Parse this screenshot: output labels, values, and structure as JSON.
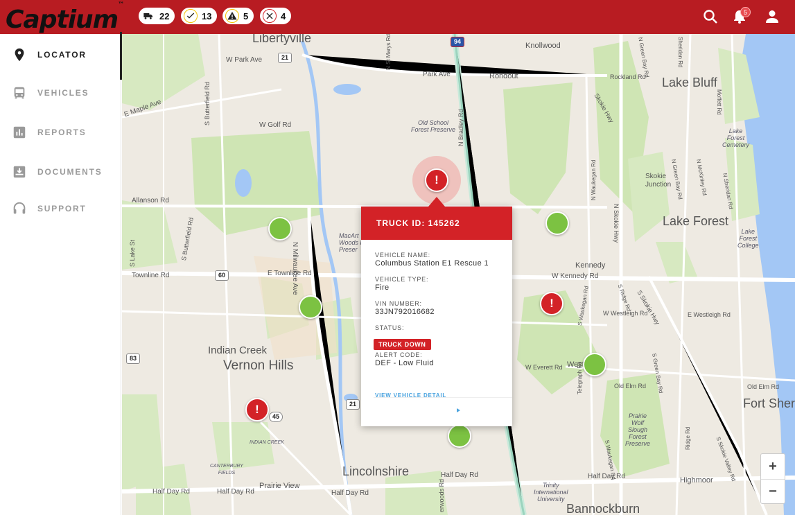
{
  "brand": {
    "name": "Captium",
    "mark": "™"
  },
  "header": {
    "counters": [
      {
        "icon": "truck-icon",
        "value": "22"
      },
      {
        "icon": "check-icon",
        "value": "13"
      },
      {
        "icon": "warning-icon",
        "value": "5"
      },
      {
        "icon": "x-icon",
        "value": "4"
      }
    ],
    "notification_count": "5"
  },
  "sidebar": {
    "items": [
      {
        "label": "LOCATOR",
        "icon": "map-pin-icon",
        "active": true
      },
      {
        "label": "VEHICLES",
        "icon": "bus-icon",
        "active": false
      },
      {
        "label": "REPORTS",
        "icon": "bar-chart-icon",
        "active": false
      },
      {
        "label": "DOCUMENTS",
        "icon": "document-download-icon",
        "active": false
      },
      {
        "label": "SUPPORT",
        "icon": "headset-icon",
        "active": false
      }
    ]
  },
  "map": {
    "places": {
      "libertyville": "Libertyville",
      "lake_bluff": "Lake Bluff",
      "lake_forest": "Lake Forest",
      "vernon_hills": "Vernon Hills",
      "indian_creek": "Indian Creek",
      "lincolnshire": "Lincolnshire",
      "bannockburn": "Bannockburn",
      "fort_sheridan": "Fort Sher",
      "knollwood": "Knollwood",
      "rondout": "Rondout",
      "kennedy": "Kennedy",
      "skokie_junction": "Skokie\nJunction",
      "prairie_view": "Prairie View",
      "highmoor": "Highmoor",
      "west_fork": "West",
      "old_school": "Old School\nForest Preserve",
      "mcarthur": "MacArt\nWoods F\nPreser",
      "lake_forest_cemetery": "Lake\nForest\nCemetery",
      "lake_forest_college": "Lake\nForest\nCollege",
      "prairie_wolf": "Prairie\nWolf\nSlough\nForest\nPreserve",
      "trinity": "Trinity\nInternational\nUniversity",
      "canterbury": "CANTERBURY\nFIELDS",
      "indian_creek_small": "INDIAN CREEK"
    },
    "roads": {
      "w_park_ave": "W Park Ave",
      "park_ave": "Park Ave",
      "e_maple_ave": "E Maple Ave",
      "w_golf_rd": "W Golf Rd",
      "allanson_rd": "Allanson Rd",
      "townline_rd": "Townline Rd",
      "e_townline_rd": "E Townline Rd",
      "w_kennedy_rd": "W Kennedy Rd",
      "w_westleigh_rd": "W Westleigh Rd",
      "e_westleigh_rd": "E Westleigh Rd",
      "w_everett_rd": "W Everett Rd",
      "old_elm_rd": "Old Elm Rd",
      "old_elm_rd2": "Old Elm Rd",
      "half_day_rd1": "Half Day Rd",
      "half_day_rd2": "Half Day Rd",
      "half_day_rd3": "Half Day Rd",
      "half_day_rd4": "Half Day Rd",
      "half_day_rd5": "Half Day Rd",
      "rockland_rd": "Rockland Rd",
      "n_milwaukee": "N Milwaukee Ave",
      "s_butterfield": "S Butterfield Rd",
      "s_butterfield2": "S Butterfield Rd",
      "s_lake_st": "S Lake St",
      "n_st_marys": "N St Marys Rd",
      "n_bradley": "N Bradley Rd",
      "skokie_hwy": "Skokie Hwy",
      "n_skokie_hwy": "N Skokie Hwy",
      "s_skokie_hwy": "S Skokie Hwy",
      "n_waukegan": "N Waukegan Rd",
      "s_waukegan": "S Waukegan Rd",
      "s_waukegan2": "S Waukegan Rd",
      "n_green_bay": "N Green Bay Rd",
      "s_green_bay": "S Green Bay Rd",
      "n_mckinley": "N McKinley Rd",
      "n_sheridan": "N Sheridan Rd",
      "moffett": "Moffett Rd",
      "s_ridge": "S Ridge Rd",
      "telegraph": "Telegraph Rd",
      "ridge_rd": "Ridge Rd",
      "sheridan_rd": "Sheridan Rd",
      "s_skokie_valley": "S Skokie Valley Rd",
      "n_green_bay_top": "N Green Bay Rd",
      "ashwoods": "erwoods Rd"
    },
    "shields": {
      "r21a": "21",
      "r21b": "21",
      "r60": "60",
      "r83": "83",
      "r45": "45",
      "i94": "94"
    }
  },
  "popup": {
    "title": "TRUCK ID: 145262",
    "vehicle_name_label": "VEHICLE NAME:",
    "vehicle_name": "Columbus Station E1 Rescue 1",
    "vehicle_type_label": "VEHICLE TYPE:",
    "vehicle_type": "Fire",
    "vin_label": "VIN NUMBER:",
    "vin": "33JN792016682",
    "status_label": "STATUS:",
    "status": "TRUCK DOWN",
    "alert_code_label": "ALERT CODE:",
    "alert_code": "DEF - Low Fluid",
    "link": "VIEW VEHICLE DETAIL"
  },
  "zoom": {
    "in": "+",
    "out": "−"
  },
  "colors": {
    "brand_red": "#b81c22",
    "alert_red": "#d32227",
    "ok_green": "#7cc242",
    "link_blue": "#4aa3df"
  }
}
